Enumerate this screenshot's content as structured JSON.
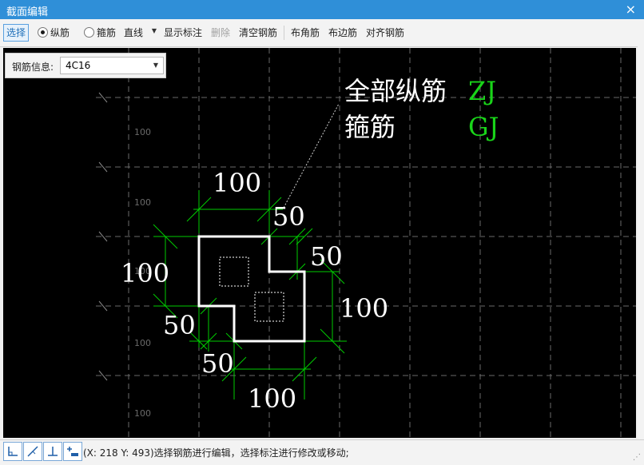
{
  "window": {
    "title": "截面编辑",
    "close_glyph": "×"
  },
  "toolbar": {
    "select": "选择",
    "longitudinal": "纵筋",
    "stirrup": "箍筋",
    "line_type": "直线",
    "show_annotation": "显示标注",
    "delete": "删除",
    "clear_rebar": "清空钢筋",
    "corner_rebar": "布角筋",
    "edge_rebar": "布边筋",
    "align_rebar": "对齐钢筋"
  },
  "info_panel": {
    "label": "钢筋信息:",
    "value": "4C16"
  },
  "canvas": {
    "grid_labels": [
      "100",
      "100",
      "100",
      "100",
      "100"
    ],
    "legend": [
      {
        "label": "全部纵筋",
        "code": "ZJ"
      },
      {
        "label": "箍筋",
        "code": "GJ"
      }
    ],
    "dims": {
      "top": "100",
      "top_notch": "50",
      "right_notch": "50",
      "left": "100",
      "right": "100",
      "bottom_left": "50",
      "bottom_notch": "50",
      "bottom": "100"
    },
    "colors": {
      "background": "#000000",
      "dimension": "#00cc00",
      "outline": "#ffffff",
      "grid": "#6a6a6a",
      "code": "#19d419"
    }
  },
  "status": {
    "text": "(X: 218 Y: 493)选择钢筋进行编辑，选择标注进行修改或移动;",
    "tool_icons": [
      "orthogonal-icon",
      "oblique-icon",
      "perpendicular-icon",
      "add-dimension-icon"
    ]
  }
}
